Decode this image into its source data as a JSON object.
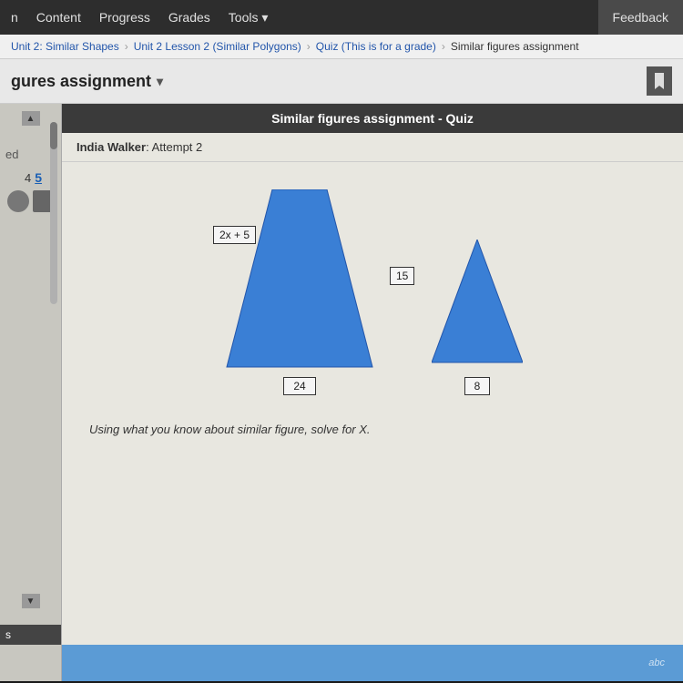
{
  "nav": {
    "items": [
      "n",
      "Content",
      "Progress",
      "Grades",
      "Tools ▾"
    ],
    "feedback_label": "Feedback"
  },
  "breadcrumb": {
    "items": [
      "Unit 2: Similar Shapes",
      "Unit 2 Lesson 2 (Similar Polygons)",
      "Quiz (This is for a grade)",
      "Similar figures assignment"
    ]
  },
  "page_title": "gures assignment",
  "quiz": {
    "header": "Similar figures assignment - Quiz",
    "student": "India Walker",
    "attempt": "Attempt 2"
  },
  "shapes": {
    "trapezoid": {
      "side_label": "2x + 5",
      "bottom_label": "24"
    },
    "triangle": {
      "side_label": "15",
      "bottom_label": "8"
    }
  },
  "question": "Using what you know about similar figure, solve for X.",
  "sidebar": {
    "text_ed": "ed",
    "number": "5",
    "bottom_label": "s"
  },
  "bottom_bar": {
    "abc_text": "abc"
  }
}
